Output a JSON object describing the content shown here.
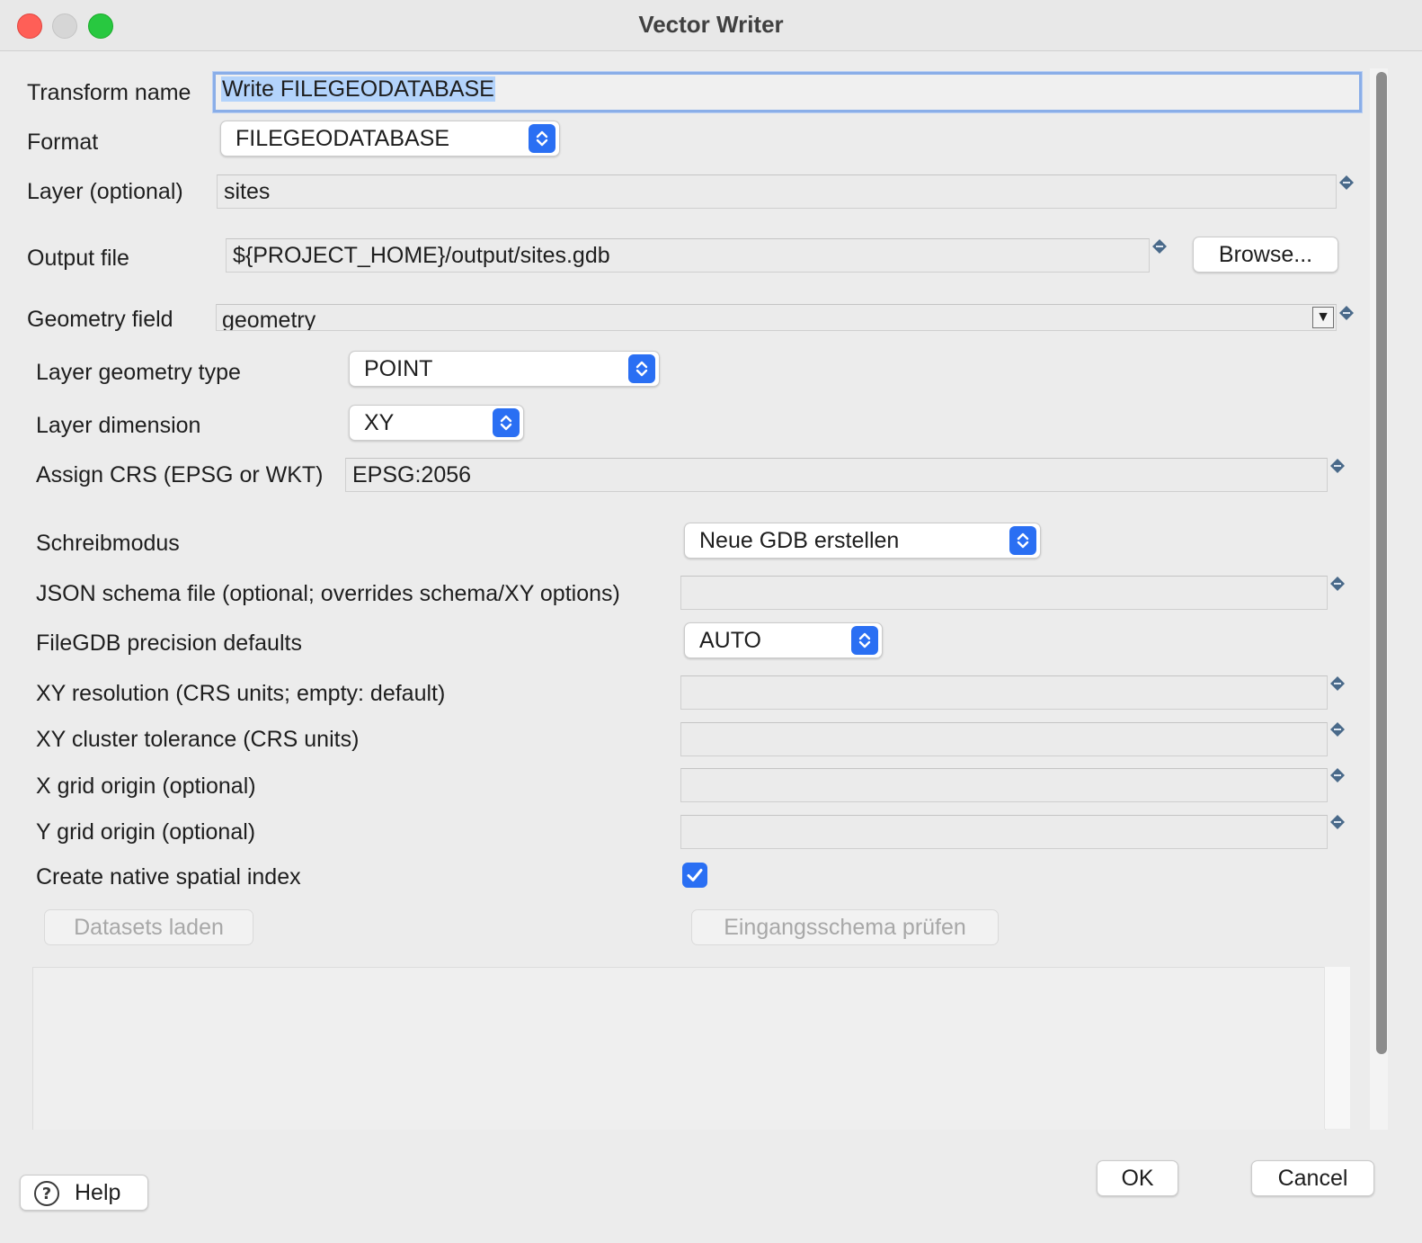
{
  "window": {
    "title": "Vector Writer"
  },
  "form": {
    "transform_name": {
      "label": "Transform name",
      "value": "Write FILEGEODATABASE"
    },
    "format": {
      "label": "Format",
      "value": "FILEGEODATABASE"
    },
    "layer": {
      "label": "Layer (optional)",
      "value": "sites"
    },
    "output_file": {
      "label": "Output file",
      "value": "${PROJECT_HOME}/output/sites.gdb",
      "browse_label": "Browse..."
    },
    "geometry_field": {
      "label": "Geometry field",
      "value": "geometry"
    },
    "layer_geometry_type": {
      "label": "Layer geometry type",
      "value": "POINT"
    },
    "layer_dimension": {
      "label": "Layer dimension",
      "value": "XY"
    },
    "assign_crs": {
      "label": "Assign CRS (EPSG or WKT)",
      "value": "EPSG:2056"
    },
    "schreibmodus": {
      "label": "Schreibmodus",
      "value": "Neue GDB erstellen"
    },
    "json_schema_file": {
      "label": "JSON schema file (optional; overrides schema/XY options)",
      "value": ""
    },
    "precision_defaults": {
      "label": "FileGDB precision defaults",
      "value": "AUTO"
    },
    "xy_resolution": {
      "label": "XY resolution (CRS units; empty: default)",
      "value": ""
    },
    "xy_cluster_tolerance": {
      "label": "XY cluster tolerance (CRS units)",
      "value": ""
    },
    "x_grid_origin": {
      "label": "X grid origin (optional)",
      "value": ""
    },
    "y_grid_origin": {
      "label": "Y grid origin (optional)",
      "value": ""
    },
    "spatial_index": {
      "label": "Create native spatial index",
      "checked": true
    }
  },
  "actions": {
    "load_datasets": "Datasets laden",
    "check_schema": "Eingangsschema prüfen"
  },
  "footer": {
    "help": "Help",
    "ok": "OK",
    "cancel": "Cancel"
  },
  "colors": {
    "accent": "#2a6ff3",
    "focus_ring": "#8aaee8",
    "close": "#ff5f57",
    "maximize": "#28c840"
  }
}
